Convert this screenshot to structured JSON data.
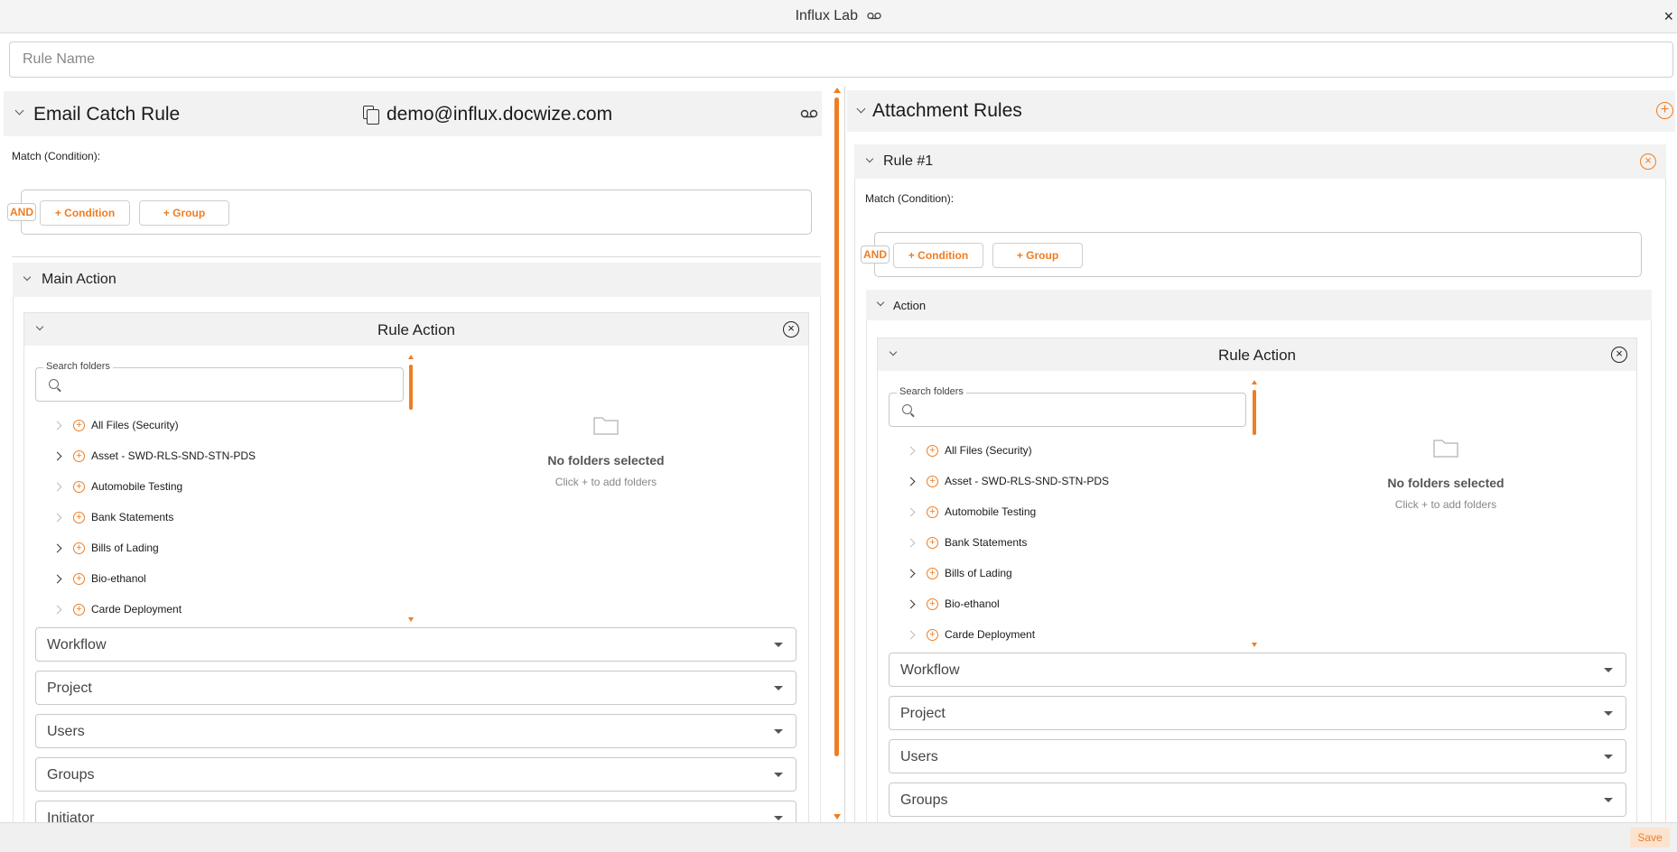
{
  "window": {
    "title": "Influx Lab",
    "close_glyph": "×"
  },
  "rule_name": {
    "placeholder": "Rule Name",
    "value": ""
  },
  "left_panel": {
    "header_title": "Email Catch Rule",
    "email": "demo@influx.docwize.com",
    "match_label": "Match (Condition):",
    "and_label": "AND",
    "add_condition": "+ Condition",
    "add_group": "+ Group",
    "main_action_label": "Main Action",
    "rule_action": {
      "title": "Rule Action",
      "search_label": "Search folders",
      "search_placeholder": "",
      "empty_title": "No folders selected",
      "empty_subtitle": "Click + to add folders",
      "selects": [
        "Workflow",
        "Project",
        "Users",
        "Groups",
        "Initiator"
      ]
    }
  },
  "right_panel": {
    "header_title": "Attachment Rules",
    "rule_title": "Rule #1",
    "match_label": "Match (Condition):",
    "and_label": "AND",
    "add_condition": "+ Condition",
    "add_group": "+ Group",
    "action_label": "Action",
    "rule_action": {
      "title": "Rule Action",
      "search_label": "Search folders",
      "search_placeholder": "",
      "empty_title": "No folders selected",
      "empty_subtitle": "Click + to add folders",
      "selects": [
        "Workflow",
        "Project",
        "Users",
        "Groups"
      ]
    }
  },
  "folders": [
    {
      "name": "All Files (Security)",
      "expandable": false
    },
    {
      "name": "Asset - SWD-RLS-SND-STN-PDS",
      "expandable": true
    },
    {
      "name": "Automobile Testing",
      "expandable": false
    },
    {
      "name": "Bank Statements",
      "expandable": false
    },
    {
      "name": "Bills of Lading",
      "expandable": true
    },
    {
      "name": "Bio-ethanol",
      "expandable": true
    },
    {
      "name": "Carde Deployment",
      "expandable": false
    }
  ],
  "footer": {
    "save_label": "Save"
  },
  "colors": {
    "accent": "#ef7d22",
    "header_bg": "#f2f2f2",
    "border": "#c8c8c8"
  },
  "icons": [
    "voicemail-icon",
    "close-icon",
    "copy-icon",
    "chevron-down-icon",
    "chevron-right-icon",
    "plus-circle-icon",
    "close-circle-icon",
    "search-icon",
    "folder-icon",
    "caret-down-icon"
  ]
}
